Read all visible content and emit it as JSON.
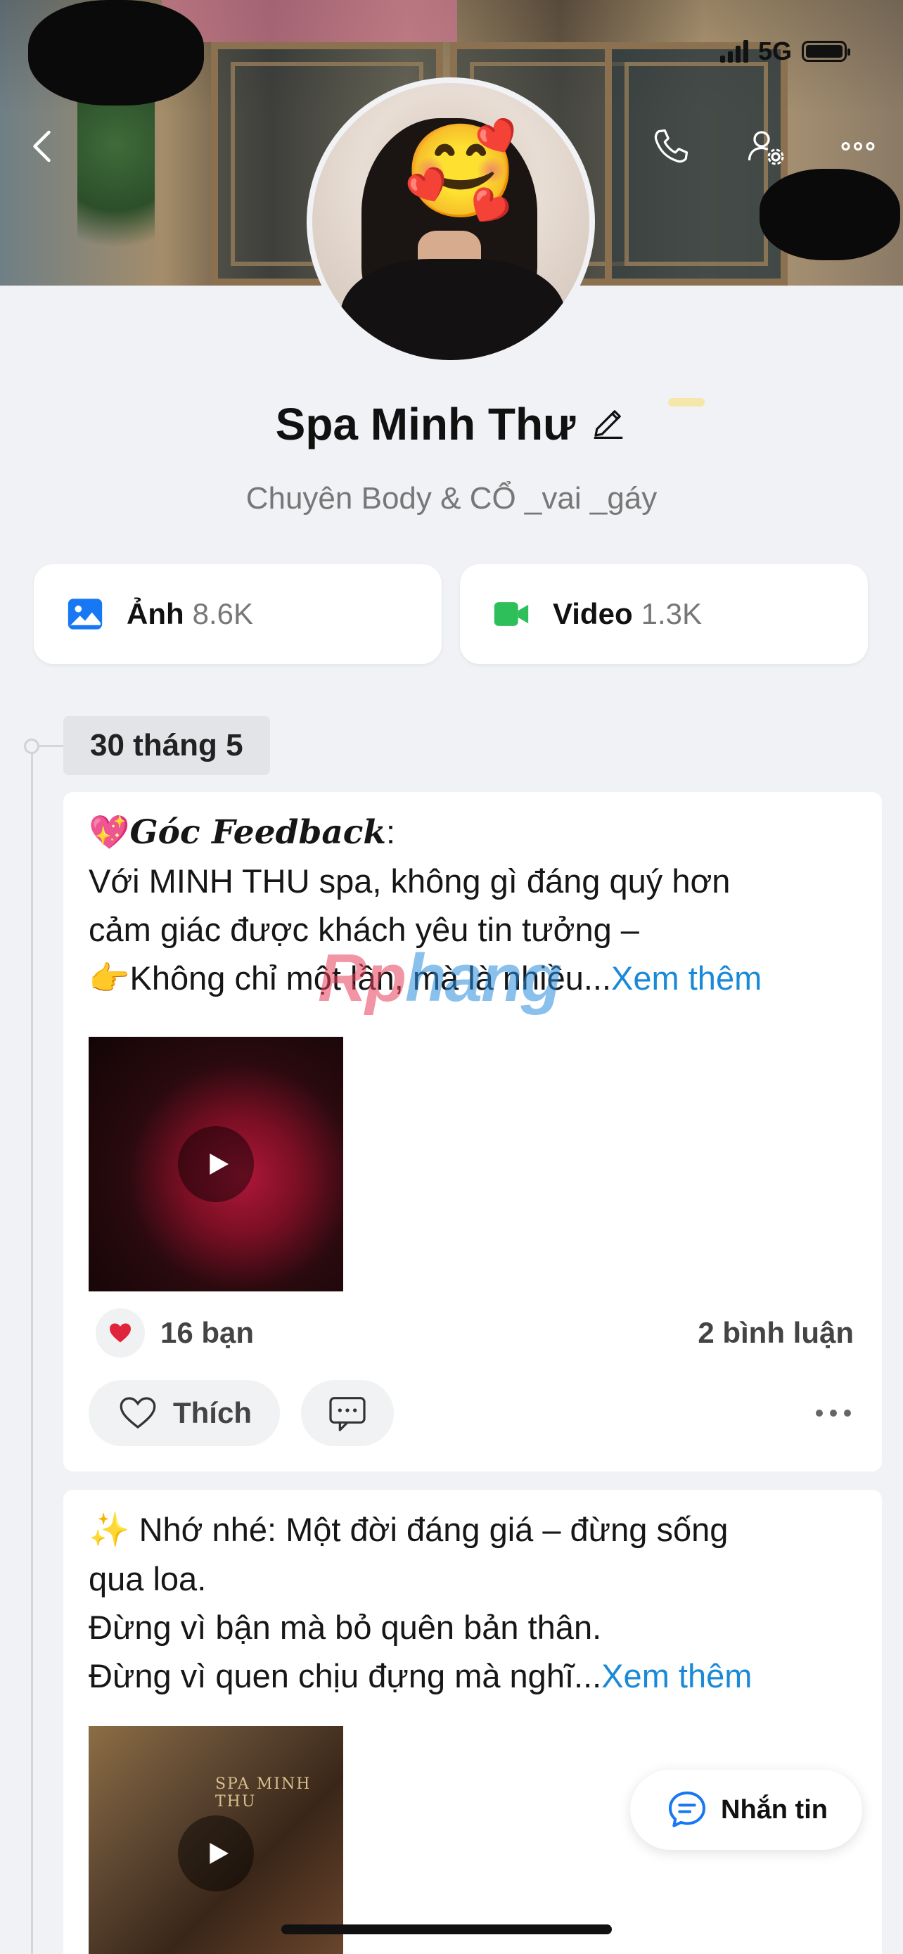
{
  "status_bar": {
    "network": "5G"
  },
  "profile": {
    "name": "Spa Minh Thư",
    "bio": "Chuyên Body & CỔ _vai _gáy"
  },
  "media": {
    "photos": {
      "label": "Ảnh",
      "count": "8.6K",
      "icon": "image-icon",
      "color": "#1877f2"
    },
    "videos": {
      "label": "Video",
      "count": "1.3K",
      "icon": "video-icon",
      "color": "#2fbf5a"
    }
  },
  "timeline": {
    "date_label": "30 tháng 5"
  },
  "posts": [
    {
      "emoji_title": "💖",
      "title": "Góc Feedback",
      "title_suffix": ":",
      "line1": "Với MINH THU spa, không gì đáng quý hơn",
      "line2": "cảm giác được khách yêu tin tưởng –",
      "emoji_line3": "👉",
      "line3": "Không chỉ một lần, mà là nhiều...",
      "see_more": "Xem thêm",
      "reaction_count": "16 bạn",
      "comment_count": "2 bình luận",
      "like_label": "Thích"
    },
    {
      "emoji_title": "✨",
      "line1": " Nhớ nhé: Một đời đáng giá – đừng sống",
      "line2": "qua loa.",
      "line3": "Đừng vì bận mà bỏ quên bản thân.",
      "line4": "Đừng vì quen chịu đựng mà nghĩ...",
      "see_more": "Xem thêm",
      "thumb_sign": "SPA MINH THU"
    }
  ],
  "watermark": {
    "part1": "Rp",
    "part2": "hang"
  },
  "fab": {
    "label": "Nhắn tin"
  },
  "colors": {
    "link": "#1a8ad8",
    "background": "#f1f2f5",
    "heart": "#e0243b"
  }
}
